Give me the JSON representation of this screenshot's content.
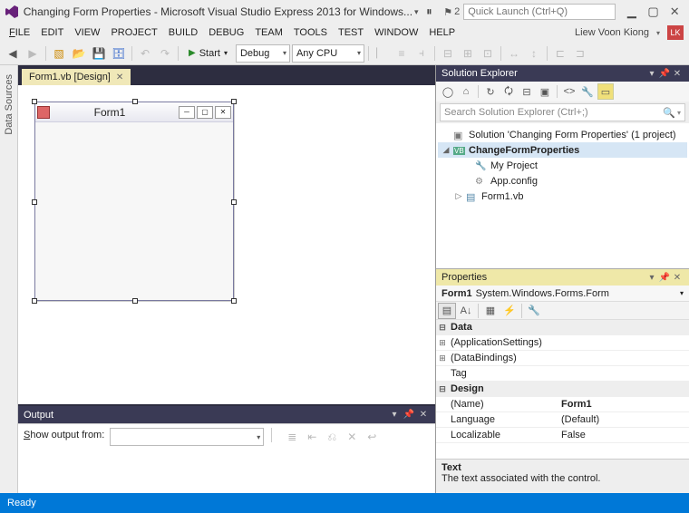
{
  "window": {
    "title": "Changing Form Properties - Microsoft Visual Studio Express 2013 for Windows...",
    "quicklaunch_placeholder": "Quick Launch (Ctrl+Q)",
    "notifications": "2"
  },
  "menu": {
    "file": "FILE",
    "edit": "EDIT",
    "view": "VIEW",
    "project": "PROJECT",
    "build": "BUILD",
    "debug": "DEBUG",
    "team": "TEAM",
    "tools": "TOOLS",
    "test": "TEST",
    "window": "WINDOW",
    "help": "HELP",
    "user": "Liew Voon Kiong",
    "user_badge": "LK"
  },
  "toolbar": {
    "start": "Start",
    "config": "Debug",
    "platform": "Any CPU"
  },
  "lefttab": {
    "datasources": "Data Sources"
  },
  "document": {
    "tab_label": "Form1.vb [Design]",
    "form_title": "Form1"
  },
  "output": {
    "title": "Output",
    "show_label": "Show output from:",
    "show_value": ""
  },
  "solution_explorer": {
    "title": "Solution Explorer",
    "search_placeholder": "Search Solution Explorer (Ctrl+;)",
    "nodes": {
      "solution": "Solution 'Changing Form Properties' (1 project)",
      "project": "ChangeFormProperties",
      "myproject": "My Project",
      "appconfig": "App.config",
      "form1": "Form1.vb"
    }
  },
  "properties": {
    "title": "Properties",
    "object_name": "Form1",
    "object_type": "System.Windows.Forms.Form",
    "categories": {
      "data": "Data",
      "design": "Design"
    },
    "rows": {
      "appsettings": "(ApplicationSettings)",
      "databindings": "(DataBindings)",
      "tag_name": "Tag",
      "tag_val": "",
      "name_name": "(Name)",
      "name_val": "Form1",
      "language_name": "Language",
      "language_val": "(Default)",
      "localizable_name": "Localizable",
      "localizable_val": "False"
    },
    "desc_title": "Text",
    "desc_body": "The text associated with the control."
  },
  "status": {
    "text": "Ready"
  }
}
